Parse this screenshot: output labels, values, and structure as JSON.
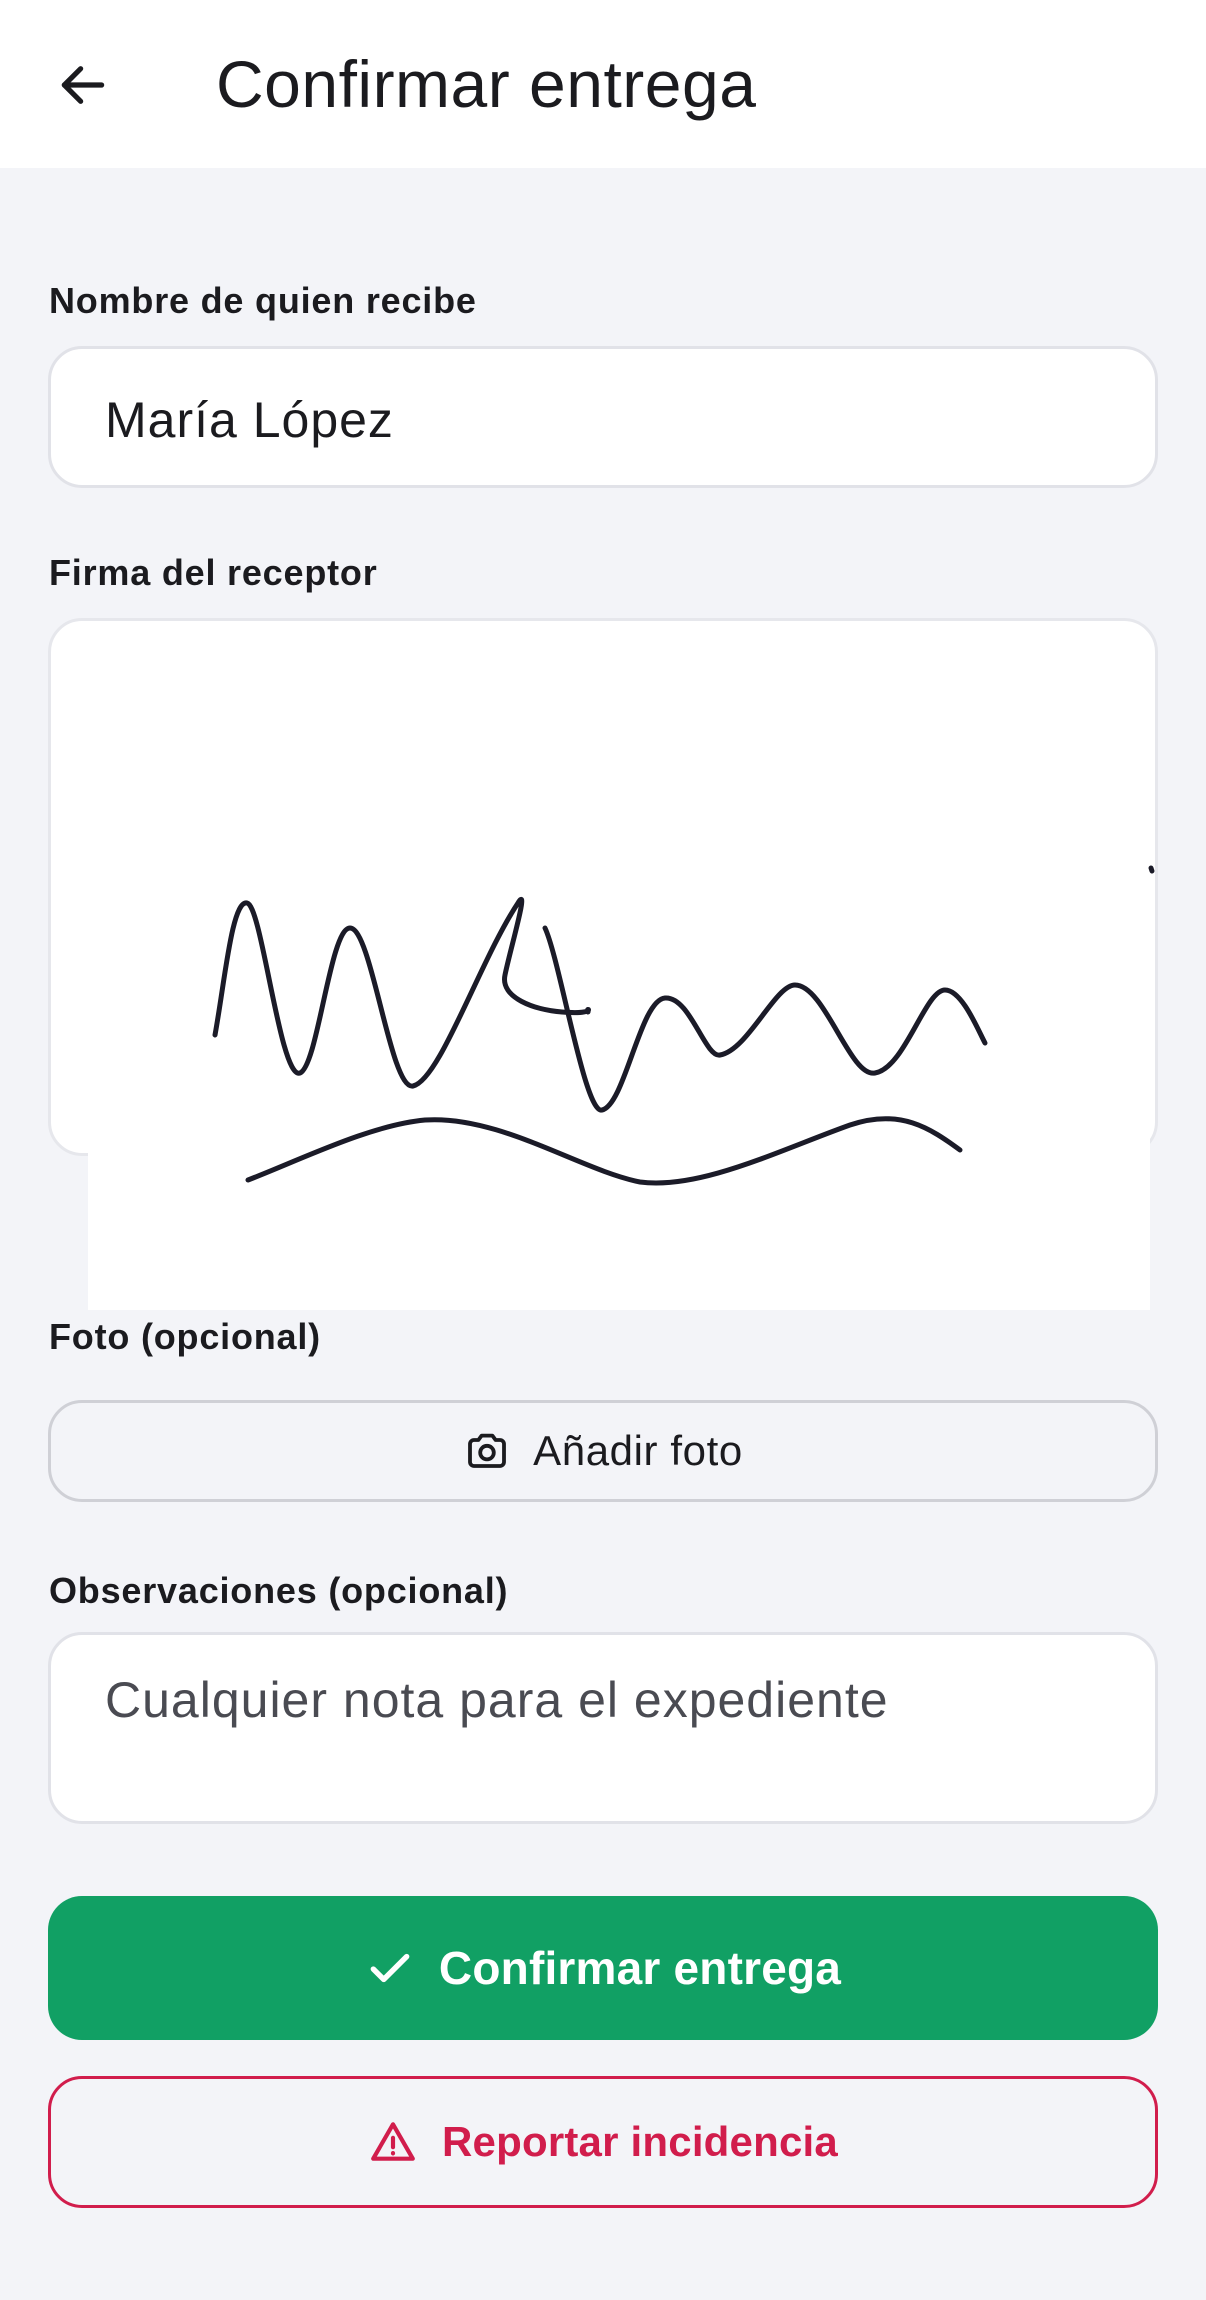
{
  "header": {
    "title": "Confirmar entrega",
    "back_icon": "arrow-left-icon"
  },
  "form": {
    "recipient_label": "Nombre de quien recibe",
    "recipient_value": "María López",
    "signature_label": "Firma del receptor",
    "photo_label": "Foto (opcional)",
    "photo_button_label": "Añadir foto",
    "photo_icon": "camera-icon",
    "notes_label": "Observaciones (opcional)",
    "notes_placeholder": "Cualquier nota para el expediente"
  },
  "actions": {
    "confirm_label": "Confirmar entrega",
    "confirm_icon": "check-icon",
    "report_label": "Reportar incidencia",
    "report_icon": "warning-triangle-icon"
  },
  "colors": {
    "confirm": "#11a064",
    "report": "#d11d4c",
    "background": "#f3f4f8"
  }
}
